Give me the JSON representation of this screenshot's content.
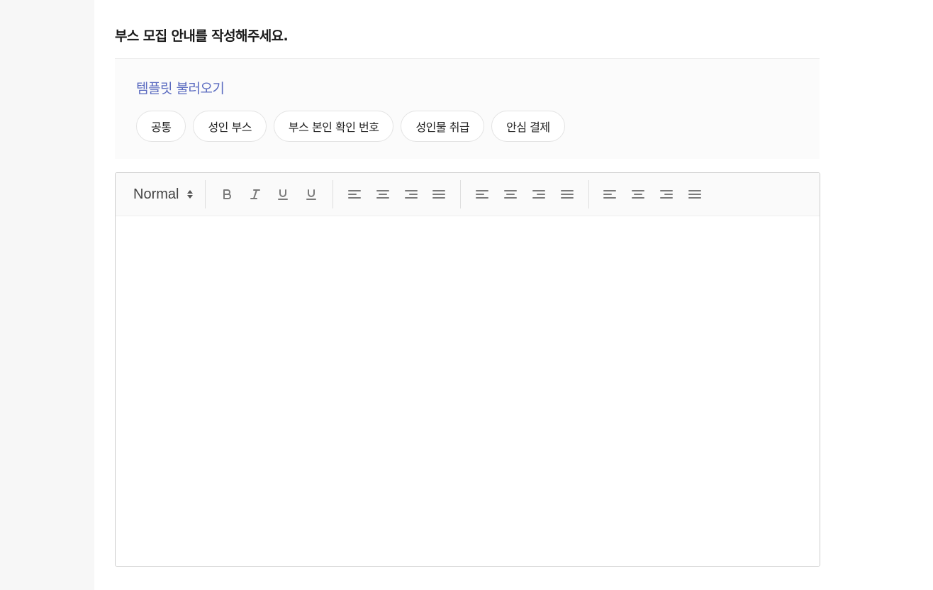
{
  "section": {
    "title": "부스 모집 안내를 작성해주세요."
  },
  "templates": {
    "link_label": "템플릿 불러오기",
    "chips": [
      "공통",
      "성인 부스",
      "부스 본인 확인 번호",
      "성인물 취급",
      "안심 결제"
    ]
  },
  "editor": {
    "format_select": "Normal",
    "toolbar_icons": [
      "bold-icon",
      "italic-icon",
      "underline-icon",
      "underline-icon",
      "align-left-icon",
      "align-center-icon",
      "align-right-icon",
      "align-justify-icon",
      "align-left-icon",
      "align-center-icon",
      "align-right-icon",
      "align-justify-icon",
      "align-left-icon",
      "align-center-icon",
      "align-right-icon",
      "align-justify-icon"
    ],
    "colors": {
      "icon": "#7a7a7a",
      "link": "#5b6bc0"
    }
  }
}
